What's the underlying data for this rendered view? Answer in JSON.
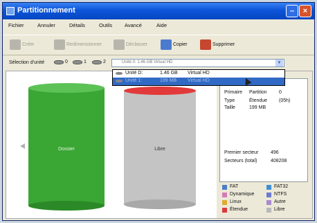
{
  "window": {
    "title": "Partitionnement"
  },
  "menu": [
    "Fichier",
    "Annuler",
    "Détails",
    "Outils",
    "Avancé",
    "Aide"
  ],
  "toolbar": {
    "create": "Créer",
    "resize": "Redimensionner",
    "unlock": "Déclasser",
    "copy": "Copier",
    "delete": "Supprimer"
  },
  "selection": {
    "label": "Sélection d'unité",
    "disks": [
      "0",
      "1",
      "2"
    ],
    "combo_value": "Unité 0:   1.46 GB   Virtual HD"
  },
  "dropdown": [
    {
      "unit": "Unité D:",
      "size": "1.46 GB",
      "type": "Virtual HD"
    },
    {
      "unit": "Unité 1:",
      "size": "199 MB",
      "type": "Virtual HD"
    }
  ],
  "partitions": [
    {
      "label": "Dossier",
      "color": "#3aa634"
    },
    {
      "label": "Libre",
      "color": "#c4c4c4",
      "top_color": "#e23a3a"
    }
  ],
  "details": {
    "primaire_label": "Primaire",
    "partition_label": "Partition",
    "partition_value": "0",
    "type_label": "Type",
    "type_value": "Étendue",
    "type_code": "(05h)",
    "taille_label": "Taille",
    "taille_value": "199 MB",
    "premier_label": "Premier secteur",
    "premier_value": "496",
    "secteurs_label": "Secteurs (total)",
    "secteurs_value": "408208"
  },
  "legend": [
    {
      "name": "FAT",
      "color": "#4a7fc6"
    },
    {
      "name": "FAT32",
      "color": "#3f8fd6"
    },
    {
      "name": "Dynamique",
      "color": "#d77ab5"
    },
    {
      "name": "NTFS",
      "color": "#6b7ad0"
    },
    {
      "name": "Linux",
      "color": "#e2a92e"
    },
    {
      "name": "Autre",
      "color": "#a98ad0"
    },
    {
      "name": "Étendue",
      "color": "#de3a3a"
    },
    {
      "name": "Libre",
      "color": "#b9b9b9"
    }
  ]
}
